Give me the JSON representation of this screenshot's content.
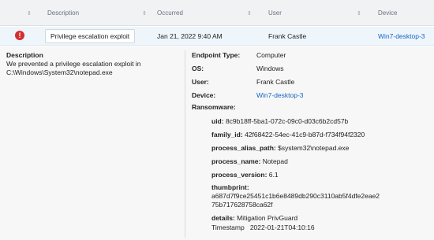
{
  "table": {
    "columns": [
      {
        "label": ""
      },
      {
        "label": "Description"
      },
      {
        "label": "Occurred"
      },
      {
        "label": "User"
      },
      {
        "label": "Device"
      }
    ]
  },
  "event": {
    "severity_icon": "exclamation-icon",
    "severity_color": "#d32f2f",
    "description": "Privilege escalation exploit",
    "occurred": "Jan 21, 2022 9:40 AM",
    "user": "Frank Castle",
    "device": "Win7-desktop-3"
  },
  "details": {
    "description_title": "Description",
    "description_text": "We prevented a privilege escalation exploit in C:\\Windows\\System32\\notepad.exe",
    "endpoint_type_label": "Endpoint Type",
    "endpoint_type_value": "Computer",
    "os_label": "OS",
    "os_value": "Windows",
    "user_label": "User",
    "user_value": "Frank Castle",
    "device_label": "Device",
    "device_value": "Win7-desktop-3",
    "ransomware_label": "Ransomware",
    "ransomware": {
      "uid_label": "uid:",
      "uid_value": "8c9b18ff-5ba1-072c-09c0-d03c6b2cd57b",
      "family_id_label": "family_id:",
      "family_id_value": "42f68422-54ec-41c9-b87d-f734f94f2320",
      "process_alias_path_label": "process_alias_path:",
      "process_alias_path_value": "$system32\\notepad.exe",
      "process_name_label": "process_name:",
      "process_name_value": "Notepad",
      "process_version_label": "process_version:",
      "process_version_value": "6.1",
      "thumbprint_label": "thumbprint:",
      "thumbprint_line1": "a687d7f9ce25451c1b6e8489db290c3110ab5f4dfe2eae2",
      "thumbprint_line2": "75b717628758ca62f",
      "details_label": "details:",
      "details_value": "Mitigation  PrivGuard",
      "timestamp_label": "Timestamp",
      "timestamp_value": "2022-01-21T04:10:16"
    }
  },
  "colors": {
    "accent_link": "#1565c0",
    "header_bg": "#f0f2f4",
    "selected_row_bg": "#eef6fc"
  }
}
